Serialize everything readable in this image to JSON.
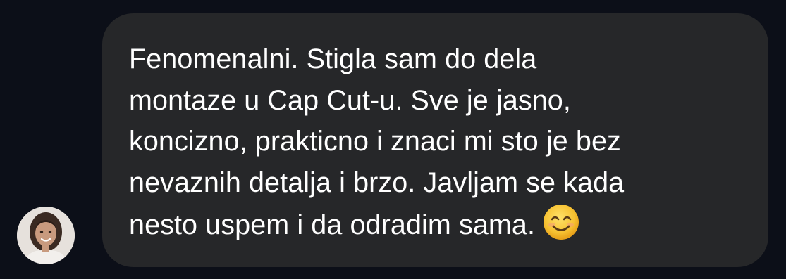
{
  "conversation": {
    "message": {
      "text": "Fenomenalni. Stigla sam do dela\nmontaze u Cap Cut-u. Sve je jasno,\nkoncizno, prakticno i znaci mi sto je bez\nnevaznih detalja i brzo. Javljam se kada\nnesto uspem i da odradim sama.",
      "emoji": "smiling-face-with-smiling-eyes-icon"
    },
    "sender": {
      "avatar_icon": "avatar-photo-icon"
    }
  },
  "colors": {
    "background": "#0c0f18",
    "bubble": "#262729",
    "text": "#ffffff",
    "emoji": "#f7c232"
  }
}
